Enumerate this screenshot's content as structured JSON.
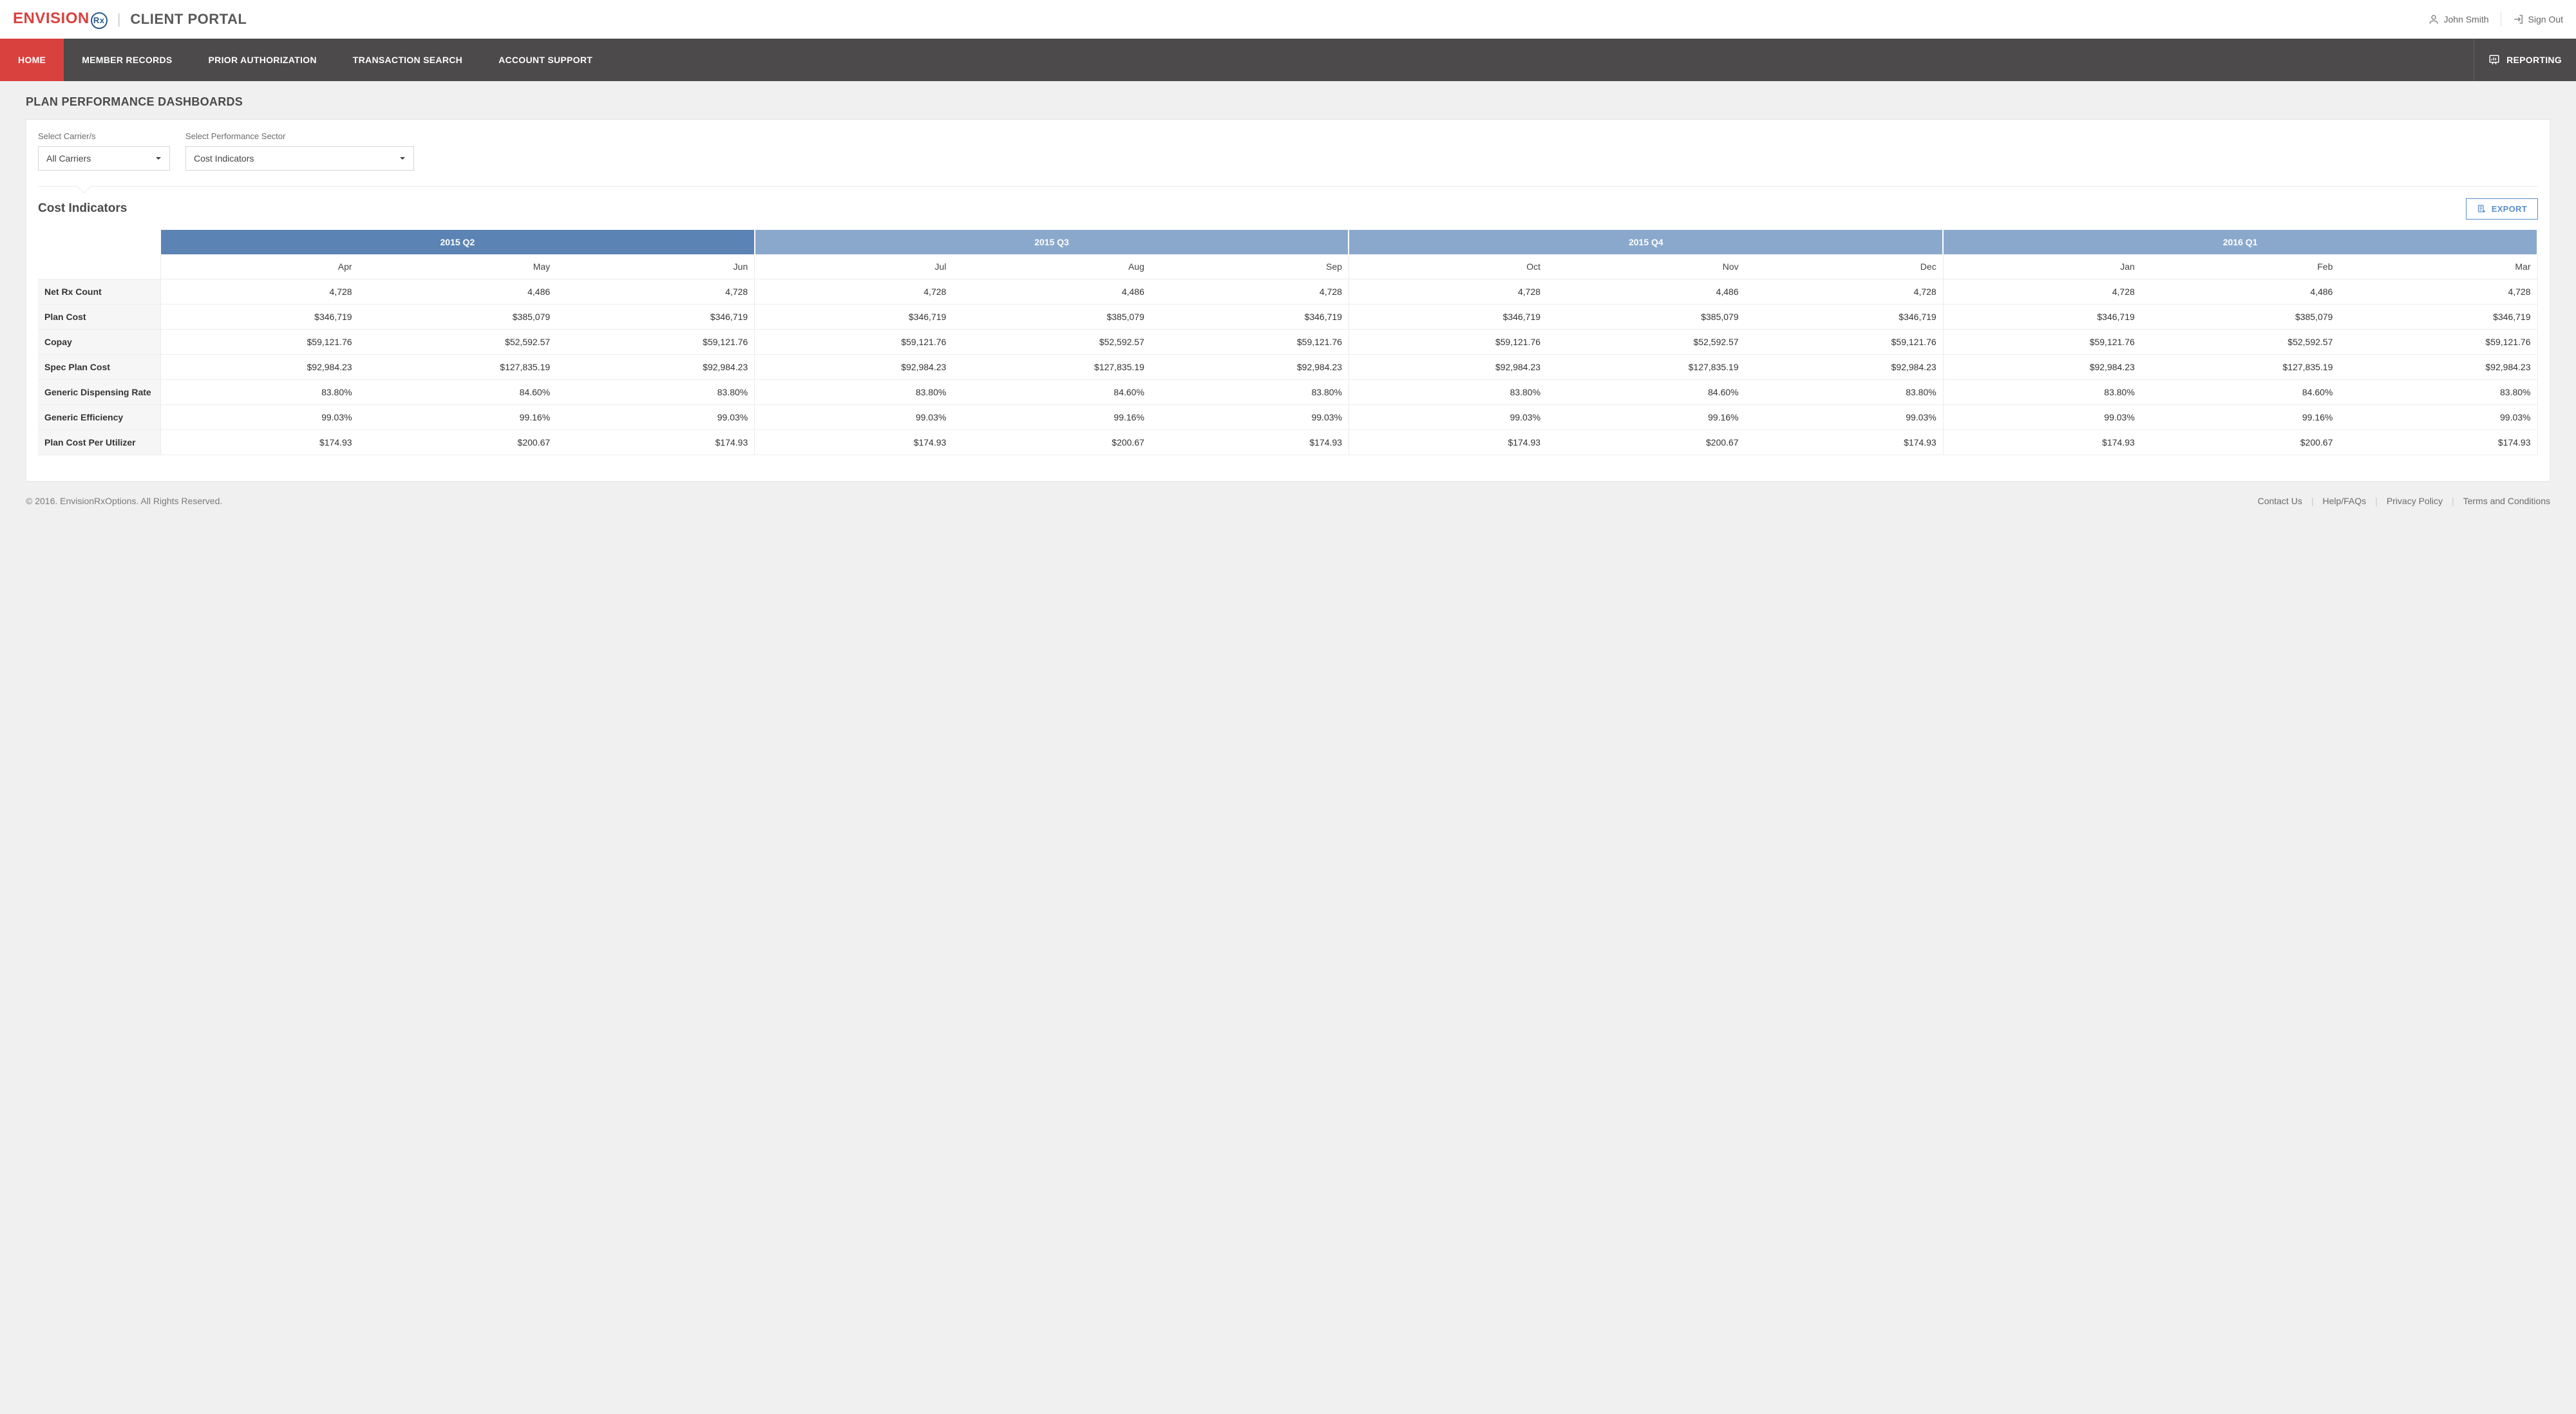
{
  "header": {
    "logo_envision": "ENVISION",
    "logo_rx": "Rx",
    "logo_divider": "|",
    "logo_portal": "CLIENT PORTAL",
    "user_name": "John Smith",
    "sign_out": "Sign Out"
  },
  "nav": {
    "items": [
      {
        "label": "HOME",
        "active": true
      },
      {
        "label": "MEMBER RECORDS"
      },
      {
        "label": "PRIOR AUTHORIZATION"
      },
      {
        "label": "TRANSACTION SEARCH"
      },
      {
        "label": "ACCOUNT SUPPORT"
      }
    ],
    "reporting": "REPORTING"
  },
  "page": {
    "title": "PLAN PERFORMANCE DASHBOARDS",
    "select_carrier_label": "Select Carrier/s",
    "select_carrier_value": "All Carriers",
    "select_sector_label": "Select Performance Sector",
    "select_sector_value": "Cost Indicators",
    "section_title": "Cost Indicators",
    "export_label": "EXPORT"
  },
  "table": {
    "quarters": [
      {
        "label": "2015 Q2",
        "color": "#5b83b4"
      },
      {
        "label": "2015 Q3",
        "color": "#8aa8cc"
      },
      {
        "label": "2015 Q4",
        "color": "#8aa8cc"
      },
      {
        "label": "2016 Q1",
        "color": "#8aa8cc"
      }
    ],
    "months": [
      "Apr",
      "May",
      "Jun",
      "Jul",
      "Aug",
      "Sep",
      "Oct",
      "Nov",
      "Dec",
      "Jan",
      "Feb",
      "Mar"
    ],
    "rows": [
      {
        "label": "Net Rx Count",
        "values": [
          "4,728",
          "4,486",
          "4,728",
          "4,728",
          "4,486",
          "4,728",
          "4,728",
          "4,486",
          "4,728",
          "4,728",
          "4,486",
          "4,728"
        ]
      },
      {
        "label": "Plan Cost",
        "values": [
          "$346,719",
          "$385,079",
          "$346,719",
          "$346,719",
          "$385,079",
          "$346,719",
          "$346,719",
          "$385,079",
          "$346,719",
          "$346,719",
          "$385,079",
          "$346,719"
        ]
      },
      {
        "label": "Copay",
        "values": [
          "$59,121.76",
          "$52,592.57",
          "$59,121.76",
          "$59,121.76",
          "$52,592.57",
          "$59,121.76",
          "$59,121.76",
          "$52,592.57",
          "$59,121.76",
          "$59,121.76",
          "$52,592.57",
          "$59,121.76"
        ]
      },
      {
        "label": "Spec Plan Cost",
        "values": [
          "$92,984.23",
          "$127,835.19",
          "$92,984.23",
          "$92,984.23",
          "$127,835.19",
          "$92,984.23",
          "$92,984.23",
          "$127,835.19",
          "$92,984.23",
          "$92,984.23",
          "$127,835.19",
          "$92,984.23"
        ]
      },
      {
        "label": "Generic Dispensing Rate",
        "values": [
          "83.80%",
          "84.60%",
          "83.80%",
          "83.80%",
          "84.60%",
          "83.80%",
          "83.80%",
          "84.60%",
          "83.80%",
          "83.80%",
          "84.60%",
          "83.80%"
        ]
      },
      {
        "label": "Generic Efficiency",
        "values": [
          "99.03%",
          "99.16%",
          "99.03%",
          "99.03%",
          "99.16%",
          "99.03%",
          "99.03%",
          "99.16%",
          "99.03%",
          "99.03%",
          "99.16%",
          "99.03%"
        ]
      },
      {
        "label": "Plan Cost Per Utilizer",
        "values": [
          "$174.93",
          "$200.67",
          "$174.93",
          "$174.93",
          "$200.67",
          "$174.93",
          "$174.93",
          "$200.67",
          "$174.93",
          "$174.93",
          "$200.67",
          "$174.93"
        ]
      }
    ]
  },
  "footer": {
    "copyright": "© 2016. EnvisionRxOptions. All Rights Reserved.",
    "links": [
      "Contact Us",
      "Help/FAQs",
      "Privacy Policy",
      "Terms and Conditions"
    ]
  }
}
